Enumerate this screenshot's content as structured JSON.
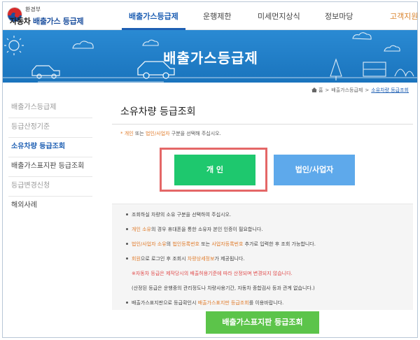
{
  "header": {
    "ministry": "환경부",
    "site_title_prefix": "자동차 ",
    "site_title_main": "배출가스 등급제",
    "nav": [
      {
        "label": "배출가스등급제"
      },
      {
        "label": "운행제한"
      },
      {
        "label": "미세먼지상식"
      },
      {
        "label": "정보마당"
      },
      {
        "label": "고객지원"
      }
    ]
  },
  "banner": {
    "title": "배출가스등급제"
  },
  "breadcrumb": {
    "home": "홈",
    "parent": "배출가스등급제",
    "current": "소유차량 등급조회"
  },
  "sidebar": {
    "items": [
      {
        "label": "배출가스등급제"
      },
      {
        "label": "등급산정기준"
      },
      {
        "label": "소유차량 등급조회"
      },
      {
        "label": "배출가스표지판 등급조회"
      },
      {
        "label": "등급변경신청"
      },
      {
        "label": "해외사례"
      }
    ]
  },
  "main": {
    "title": "소유차량 등급조회",
    "notice": {
      "star": "*",
      "opt1": "개인",
      "mid": " 또는 ",
      "opt2": "법인/사업자",
      "tail": " 구분을 선택해 주십시오."
    },
    "buttons": {
      "person": "개 인",
      "corp": "법인/사업자"
    },
    "info": {
      "l1": "조회하실 차량의 소유 구분을 선택하여 주십시오.",
      "l2a": "개인 소유",
      "l2b": "의 경우 휴대폰을 통한 소유자 본인 인증이 필요합니다.",
      "l3a": "법인/사업자 소유",
      "l3b": "의 ",
      "l3c": "법인등록번호",
      "l3d": " 또는 ",
      "l3e": "사업자등록번호",
      "l3f": " 추가로 입력한 후 조회 가능합니다.",
      "l4a": "회원",
      "l4b": "으로 로그인 후 조회시 ",
      "l4c": "차량상세정보",
      "l4d": "가 제공됩니다.",
      "l5": "※자동차 등급은 제작당시의 배출허용기준에 따라 산정되며 변경되지 않습니다.",
      "l6": "(산정된 등급은 운행중의 관리정도나 차량사용기간, 자동차 종합검사 등과 관계 없습니다.)",
      "l7a": "배출가스표지판으로 등급확인시 ",
      "l7b": "배출가스표지판 등급조회",
      "l7c": "를 이용바랍니다."
    },
    "lookup_button": "배출가스표지판 등급조회"
  },
  "colors": {
    "primary": "#1e5fb3",
    "banner": "#1f7fc9",
    "person_button": "#1ec86e",
    "corp_button": "#5ea9eb",
    "lookup_button": "#5cc44a",
    "highlight_box": "#e46767",
    "accent_orange": "#e07b2a"
  }
}
